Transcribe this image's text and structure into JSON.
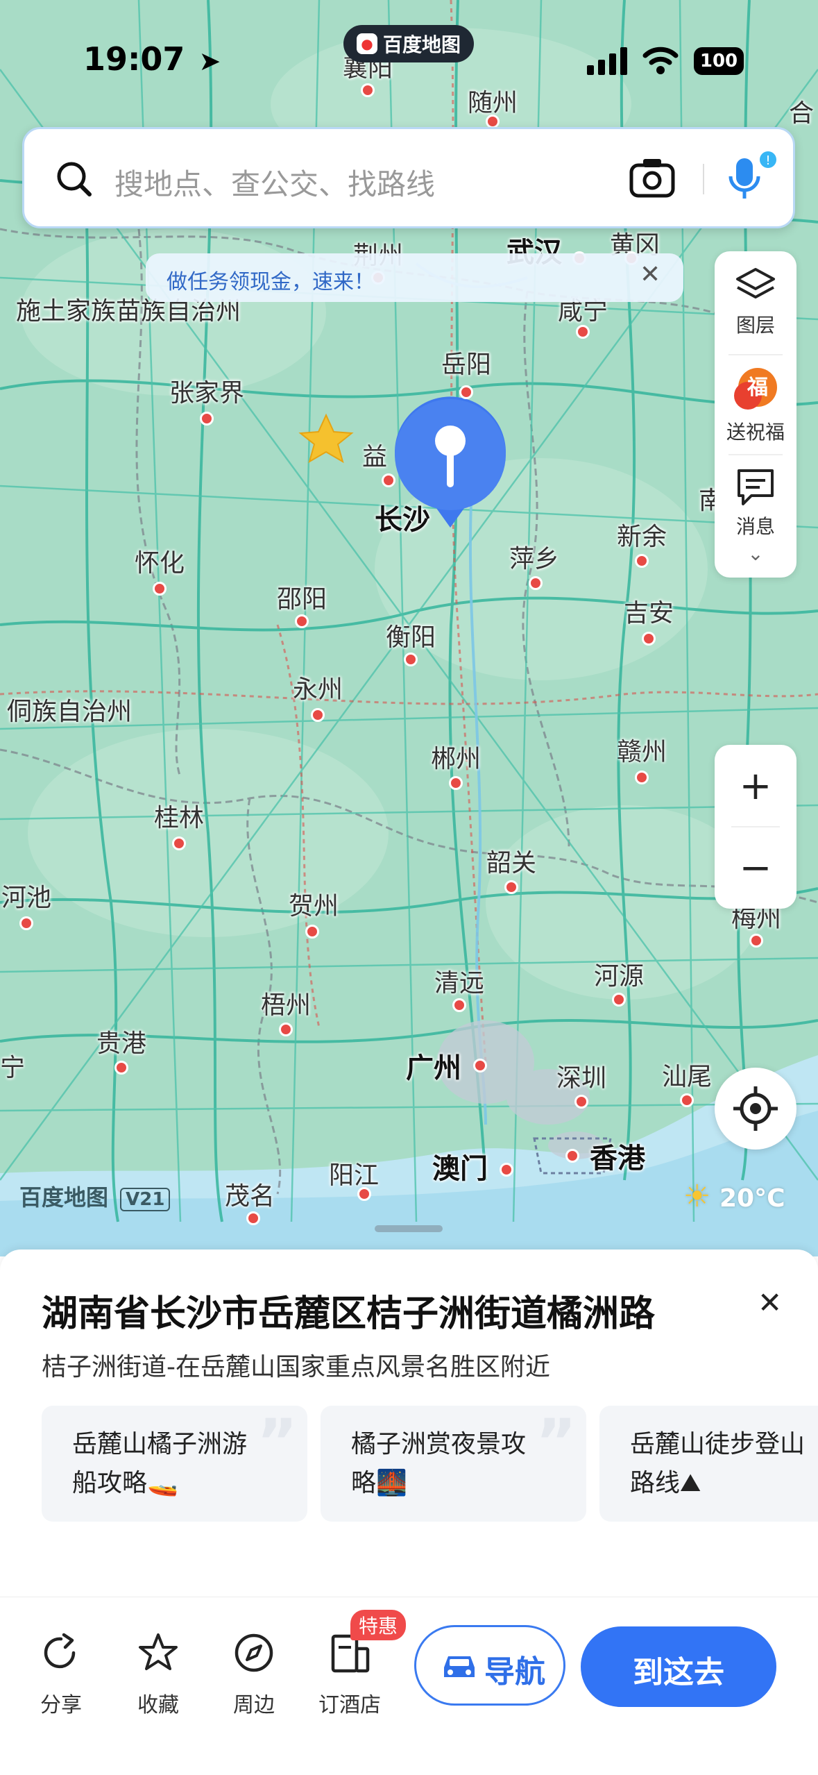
{
  "status_bar": {
    "time": "19:07",
    "app_badge": "百度地图",
    "battery": "100"
  },
  "search": {
    "placeholder": "搜地点、查公交、找路线"
  },
  "banner": {
    "text": "做任务领现金，速来！"
  },
  "side_panel": {
    "layers_label": "图层",
    "bless_label": "送祝福",
    "message_label": "消息"
  },
  "map": {
    "cities": [
      {
        "name": "襄阳"
      },
      {
        "name": "随州"
      },
      {
        "name": "合"
      },
      {
        "name": "荆州"
      },
      {
        "name": "武汉"
      },
      {
        "name": "黄冈"
      },
      {
        "name": "施土家族苗族自治州"
      },
      {
        "name": "咸宁"
      },
      {
        "name": "岳阳"
      },
      {
        "name": "张家界"
      },
      {
        "name": "益"
      },
      {
        "name": "长沙"
      },
      {
        "name": "南"
      },
      {
        "name": "怀化"
      },
      {
        "name": "新余"
      },
      {
        "name": "萍乡"
      },
      {
        "name": "邵阳"
      },
      {
        "name": "吉安"
      },
      {
        "name": "衡阳"
      },
      {
        "name": "永州"
      },
      {
        "name": "侗族自治州"
      },
      {
        "name": "郴州"
      },
      {
        "name": "赣州"
      },
      {
        "name": "桂林"
      },
      {
        "name": "韶关"
      },
      {
        "name": "河池"
      },
      {
        "name": "贺州"
      },
      {
        "name": "梅州"
      },
      {
        "name": "清远"
      },
      {
        "name": "河源"
      },
      {
        "name": "梧州"
      },
      {
        "name": "贵港"
      },
      {
        "name": "宁"
      },
      {
        "name": "广州"
      },
      {
        "name": "深圳"
      },
      {
        "name": "汕尾"
      },
      {
        "name": "阳江"
      },
      {
        "name": "澳门"
      },
      {
        "name": "香港"
      },
      {
        "name": "茂名"
      }
    ],
    "watermark": "百度地图",
    "watermark_version": "V21",
    "weather": "20°C"
  },
  "sheet": {
    "address": "湖南省长沙市岳麓区桔子洲街道橘洲路",
    "subtitle": "桔子洲街道-在岳麓山国家重点风景名胜区附近",
    "cards": [
      {
        "line1": "岳麓山橘子洲游",
        "line2": "船攻略"
      },
      {
        "line1": "橘子洲赏夜景攻",
        "line2": "略"
      },
      {
        "line1": "岳麓山徒步登山",
        "line2": "路线"
      }
    ]
  },
  "tabbar": {
    "share": "分享",
    "favorite": "收藏",
    "nearby": "周边",
    "hotel": "订酒店",
    "hotel_badge": "特惠",
    "navigate": "导航",
    "go_here": "到这去"
  },
  "colors": {
    "accent": "#3274f5",
    "map_green": "#a9dcc8",
    "city_dot": "#e74a45",
    "road": "#3ab4a0"
  }
}
